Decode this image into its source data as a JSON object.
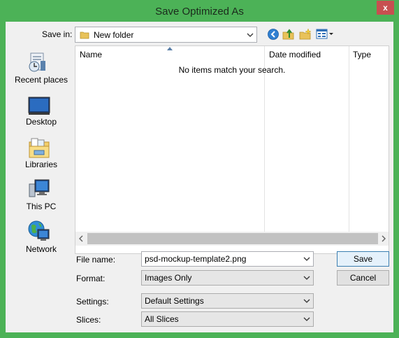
{
  "window": {
    "title": "Save Optimized As",
    "close_glyph": "x"
  },
  "toolbar": {
    "save_in_label": "Save in:",
    "folder": "New folder",
    "icons": [
      "back-icon",
      "up-folder-icon",
      "new-folder-icon",
      "view-menu-icon"
    ]
  },
  "places": [
    {
      "label": "Recent places",
      "icon": "recent-places-icon"
    },
    {
      "label": "Desktop",
      "icon": "desktop-icon"
    },
    {
      "label": "Libraries",
      "icon": "libraries-icon"
    },
    {
      "label": "This PC",
      "icon": "this-pc-icon"
    },
    {
      "label": "Network",
      "icon": "network-icon"
    }
  ],
  "file_list": {
    "columns": [
      "Name",
      "Date modified",
      "Type"
    ],
    "empty_message": "No items match your search."
  },
  "form": {
    "file_name_label": "File name:",
    "file_name_value": "psd-mockup-template2.png",
    "format_label": "Format:",
    "format_value": "Images Only",
    "settings_label": "Settings:",
    "settings_value": "Default Settings",
    "slices_label": "Slices:",
    "slices_value": "All Slices"
  },
  "buttons": {
    "save": "Save",
    "cancel": "Cancel"
  },
  "colors": {
    "frame": "#4cb257",
    "close": "#c75050",
    "accent": "#3c7fb1"
  }
}
